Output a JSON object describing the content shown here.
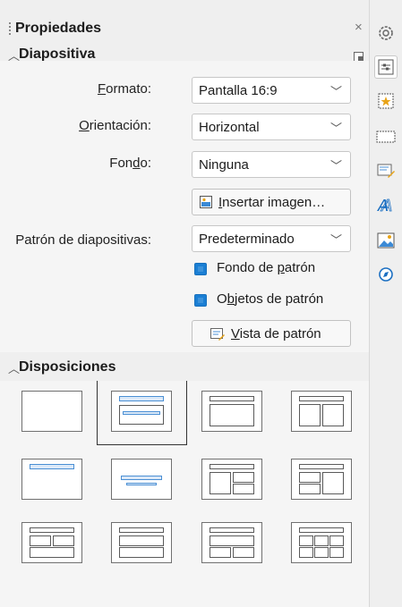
{
  "panel": {
    "title": "Propiedades",
    "close_glyph": "×"
  },
  "slide_section": {
    "title": "Diapositiva",
    "format": {
      "label_pre": "",
      "label_u": "F",
      "label_post": "ormato:",
      "value": "Pantalla 16:9"
    },
    "orientation": {
      "label_u": "O",
      "label_post": "rientación:",
      "value": "Horizontal"
    },
    "background": {
      "label_pre": "Fon",
      "label_u": "d",
      "label_post": "o:",
      "value": "Ninguna"
    },
    "insert_image": {
      "u": "I",
      "rest": "nsertar imagen…"
    },
    "master": {
      "label": "Patrón de diapositivas:",
      "value": "Predeterminado"
    },
    "master_background": {
      "pre": "Fondo de ",
      "u": "p",
      "post": "atrón"
    },
    "master_objects": {
      "pre": "O",
      "u": "b",
      "post": "jetos de patrón"
    },
    "master_view": {
      "u": "V",
      "rest": "ista de patrón"
    }
  },
  "layouts_section": {
    "title": "Disposiciones"
  },
  "sidebar_tabs": [
    "settings-icon",
    "properties-icon",
    "slide-transition-icon",
    "animation-icon",
    "master-slides-icon",
    "styles-icon",
    "gallery-icon",
    "navigator-icon"
  ],
  "colors": {
    "accent": "#1b7fd4"
  }
}
